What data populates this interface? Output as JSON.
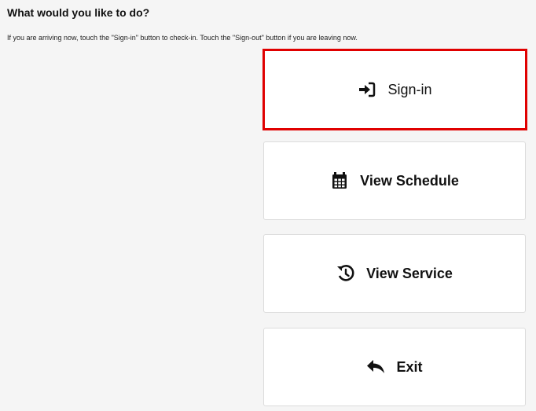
{
  "header": {
    "title": "What would you like to do?",
    "instructions": "If you are arriving now, touch the \"Sign-in\" button to check-in. Touch the \"Sign-out\" button if you are leaving now."
  },
  "actions": [
    {
      "label": "Sign-in",
      "icon": "sign-in-icon",
      "highlighted": true
    },
    {
      "label": "View Schedule",
      "icon": "calendar-icon",
      "highlighted": false
    },
    {
      "label": "View Service",
      "icon": "history-icon",
      "highlighted": false
    },
    {
      "label": "Exit",
      "icon": "reply-arrow-icon",
      "highlighted": false
    }
  ],
  "colors": {
    "highlight_border": "#e00000",
    "button_background": "#ffffff",
    "page_background": "#f5f5f5"
  }
}
